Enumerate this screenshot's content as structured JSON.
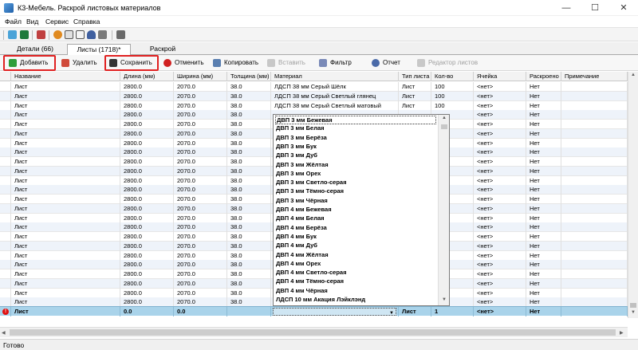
{
  "window": {
    "title": "К3-Мебель. Раскрой листовых материалов",
    "controls": {
      "minimize": "—",
      "maximize": "☐",
      "close": "✕"
    }
  },
  "menu": [
    "Файл",
    "Вид",
    "Сервис",
    "Справка"
  ],
  "tabs": [
    {
      "label": "Детали (66)",
      "active": false
    },
    {
      "label": "Листы (1718)*",
      "active": true
    },
    {
      "label": "Раскрой",
      "active": false
    }
  ],
  "actions": [
    {
      "label": "Добавить",
      "icon": "plus-icon",
      "disabled": false,
      "highlighted": true
    },
    {
      "label": "Удалить",
      "icon": "delete-icon",
      "disabled": false,
      "highlighted": false
    },
    {
      "label": "Сохранить",
      "icon": "save-icon",
      "disabled": false,
      "highlighted": true
    },
    {
      "label": "Отменить",
      "icon": "cancel-icon",
      "disabled": false,
      "highlighted": false
    },
    {
      "label": "Копировать",
      "icon": "copy-icon",
      "disabled": false,
      "highlighted": false
    },
    {
      "label": "Вставить",
      "icon": "paste-icon",
      "disabled": true,
      "highlighted": false
    },
    {
      "label": "Фильтр",
      "icon": "filter-icon",
      "disabled": false,
      "highlighted": false
    },
    {
      "label": "Отчет",
      "icon": "report-icon",
      "disabled": false,
      "highlighted": false
    },
    {
      "label": "Редактор листов",
      "icon": "sheet-editor-icon",
      "disabled": true,
      "highlighted": false
    }
  ],
  "table": {
    "columns": [
      "Название",
      "Длина (мм)",
      "Ширина (мм)",
      "Толщина (мм)",
      "Материал",
      "Тип листа",
      "Кол-во",
      "Ячейка",
      "Раскроено",
      "Примечание"
    ],
    "rows": [
      [
        "Лист",
        "2800.0",
        "2070.0",
        "38.0",
        "ЛДСП 38 мм Серый Шёлк",
        "Лист",
        "100",
        "<нет>",
        "Нет",
        ""
      ],
      [
        "Лист",
        "2800.0",
        "2070.0",
        "38.0",
        "ЛДСП 38 мм Серый Светлый глянец",
        "Лист",
        "100",
        "<нет>",
        "Нет",
        ""
      ],
      [
        "Лист",
        "2800.0",
        "2070.0",
        "38.0",
        "ЛДСП 38 мм Серый Светлый матовый",
        "Лист",
        "100",
        "<нет>",
        "Нет",
        ""
      ],
      [
        "Лист",
        "2800.0",
        "2070.0",
        "38.0",
        "",
        "",
        "",
        "<нет>",
        "Нет",
        ""
      ],
      [
        "Лист",
        "2800.0",
        "2070.0",
        "38.0",
        "",
        "",
        "",
        "<нет>",
        "Нет",
        ""
      ],
      [
        "Лист",
        "2800.0",
        "2070.0",
        "38.0",
        "",
        "",
        "",
        "<нет>",
        "Нет",
        ""
      ],
      [
        "Лист",
        "2800.0",
        "2070.0",
        "38.0",
        "",
        "",
        "",
        "<нет>",
        "Нет",
        ""
      ],
      [
        "Лист",
        "2800.0",
        "2070.0",
        "38.0",
        "",
        "",
        "",
        "<нет>",
        "Нет",
        ""
      ],
      [
        "Лист",
        "2800.0",
        "2070.0",
        "38.0",
        "",
        "",
        "",
        "<нет>",
        "Нет",
        ""
      ],
      [
        "Лист",
        "2800.0",
        "2070.0",
        "38.0",
        "",
        "",
        "",
        "<нет>",
        "Нет",
        ""
      ],
      [
        "Лист",
        "2800.0",
        "2070.0",
        "38.0",
        "",
        "",
        "",
        "<нет>",
        "Нет",
        ""
      ],
      [
        "Лист",
        "2800.0",
        "2070.0",
        "38.0",
        "",
        "",
        "",
        "<нет>",
        "Нет",
        ""
      ],
      [
        "Лист",
        "2800.0",
        "2070.0",
        "38.0",
        "",
        "",
        "",
        "<нет>",
        "Нет",
        ""
      ],
      [
        "Лист",
        "2800.0",
        "2070.0",
        "38.0",
        "",
        "",
        "",
        "<нет>",
        "Нет",
        ""
      ],
      [
        "Лист",
        "2800.0",
        "2070.0",
        "38.0",
        "",
        "",
        "",
        "<нет>",
        "Нет",
        ""
      ],
      [
        "Лист",
        "2800.0",
        "2070.0",
        "38.0",
        "",
        "",
        "",
        "<нет>",
        "Нет",
        ""
      ],
      [
        "Лист",
        "2800.0",
        "2070.0",
        "38.0",
        "",
        "",
        "",
        "<нет>",
        "Нет",
        ""
      ],
      [
        "Лист",
        "2800.0",
        "2070.0",
        "38.0",
        "",
        "",
        "",
        "<нет>",
        "Нет",
        ""
      ],
      [
        "Лист",
        "2800.0",
        "2070.0",
        "38.0",
        "",
        "",
        "",
        "<нет>",
        "Нет",
        ""
      ],
      [
        "Лист",
        "2800.0",
        "2070.0",
        "38.0",
        "",
        "",
        "",
        "<нет>",
        "Нет",
        ""
      ],
      [
        "Лист",
        "2800.0",
        "2070.0",
        "38.0",
        "",
        "",
        "",
        "<нет>",
        "Нет",
        ""
      ],
      [
        "Лист",
        "2800.0",
        "2070.0",
        "38.0",
        "",
        "",
        "",
        "<нет>",
        "Нет",
        ""
      ],
      [
        "Лист",
        "2800.0",
        "2070.0",
        "38.0",
        "",
        "",
        "",
        "<нет>",
        "Нет",
        ""
      ],
      [
        "Лист",
        "2800.0",
        "2070.0",
        "38.0",
        "",
        "",
        "",
        "<нет>",
        "Нет",
        ""
      ]
    ],
    "new_row": [
      "Лист",
      "0.0",
      "0.0",
      "",
      "",
      "Лист",
      "1",
      "<нет>",
      "Нет",
      ""
    ]
  },
  "dropdown": {
    "items": [
      "ДВП 3 мм Бежевая",
      "ДВП 3 мм Белая",
      "ДВП 3 мм Берёза",
      "ДВП 3 мм Бук",
      "ДВП 3 мм Дуб",
      "ДВП 3 мм Жёлтая",
      "ДВП 3 мм Орех",
      "ДВП 3 мм Светло-серая",
      "ДВП 3 мм Тёмно-серая",
      "ДВП 3 мм Чёрная",
      "ДВП 4 мм Бежевая",
      "ДВП 4 мм Белая",
      "ДВП 4 мм Берёза",
      "ДВП 4 мм Бук",
      "ДВП 4 мм Дуб",
      "ДВП 4 мм Жёлтая",
      "ДВП 4 мм Орех",
      "ДВП 4 мм Светло-серая",
      "ДВП 4 мм Тёмно-серая",
      "ДВП 4 мм Чёрная",
      "ЛДСП 10 мм Акация Лэйклэнд"
    ],
    "selected_index": 0
  },
  "status": {
    "text": "Готово"
  },
  "colors": {
    "highlight_box": "#e02020",
    "new_row": "#a9d3ea",
    "error": "#e01010"
  }
}
